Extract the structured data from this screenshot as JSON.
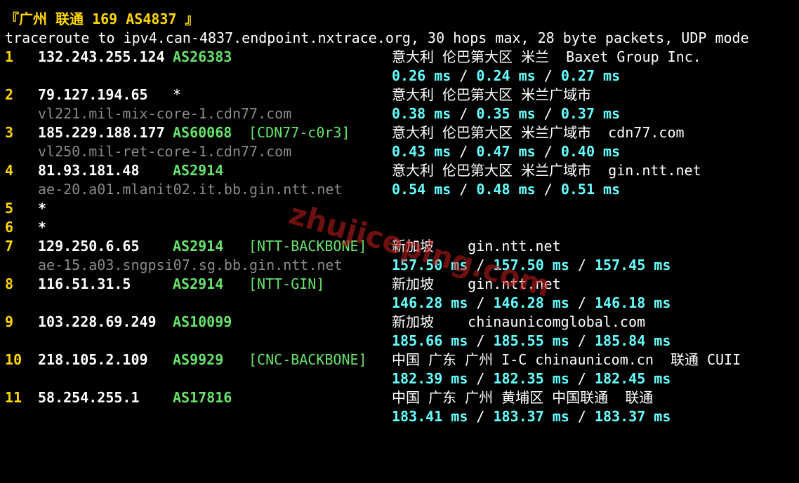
{
  "title": "『广州 联通 169 AS4837 』",
  "header": "traceroute to ipv4.can-4837.endpoint.nxtrace.org, 30 hops max, 28 byte packets, UDP mode",
  "watermark": "zhujiceping.com",
  "colors": {
    "background": "#000000",
    "hop": "#ffd700",
    "asn": "#66e36a",
    "rtt": "#66ffff",
    "rdns": "#8a8a8a",
    "text": "#ffffff"
  },
  "rtt_separator": " / ",
  "hops": [
    {
      "hop": "1",
      "ip": "132.243.255.124",
      "asn": "AS26383",
      "tag": "",
      "geo": "意大利 伦巴第大区 米兰  Baxet Group Inc.",
      "rdns": "",
      "rtt": [
        "0.26 ms",
        "0.24 ms",
        "0.27 ms"
      ]
    },
    {
      "hop": "2",
      "ip": "79.127.194.65",
      "asn": "*",
      "tag": "",
      "geo": "意大利 伦巴第大区 米兰广域市",
      "rdns": "vl221.mil-mix-core-1.cdn77.com",
      "rtt": [
        "0.38 ms",
        "0.35 ms",
        "0.37 ms"
      ]
    },
    {
      "hop": "3",
      "ip": "185.229.188.177",
      "asn": "AS60068",
      "tag": "[CDN77-c0r3]",
      "geo": "意大利 伦巴第大区 米兰广域市  cdn77.com",
      "rdns": "vl250.mil-ret-core-1.cdn77.com",
      "rtt": [
        "0.43 ms",
        "0.47 ms",
        "0.40 ms"
      ]
    },
    {
      "hop": "4",
      "ip": "81.93.181.48",
      "asn": "AS2914",
      "tag": "",
      "geo": "意大利 伦巴第大区 米兰广域市  gin.ntt.net",
      "rdns": "ae-20.a01.mlanit02.it.bb.gin.ntt.net",
      "rtt": [
        "0.54 ms",
        "0.48 ms",
        "0.51 ms"
      ]
    },
    {
      "hop": "5",
      "ip": "*",
      "asn": "",
      "tag": "",
      "geo": "",
      "rdns": "",
      "rtt": []
    },
    {
      "hop": "6",
      "ip": "*",
      "asn": "",
      "tag": "",
      "geo": "",
      "rdns": "",
      "rtt": []
    },
    {
      "hop": "7",
      "ip": "129.250.6.65",
      "asn": "AS2914",
      "tag": "[NTT-BACKBONE]",
      "geo": "新加坡    gin.ntt.net",
      "rdns": "ae-15.a03.sngpsi07.sg.bb.gin.ntt.net",
      "rtt": [
        "157.50 ms",
        "157.50 ms",
        "157.45 ms"
      ]
    },
    {
      "hop": "8",
      "ip": "116.51.31.5",
      "asn": "AS2914",
      "tag": "[NTT-GIN]",
      "geo": "新加坡    gin.ntt.net",
      "rdns": "",
      "rtt": [
        "146.28 ms",
        "146.28 ms",
        "146.18 ms"
      ]
    },
    {
      "hop": "9",
      "ip": "103.228.69.249",
      "asn": "AS10099",
      "tag": "",
      "geo": "新加坡    chinaunicomglobal.com",
      "rdns": "",
      "rtt": [
        "185.66 ms",
        "185.55 ms",
        "185.84 ms"
      ]
    },
    {
      "hop": "10",
      "ip": "218.105.2.109",
      "asn": "AS9929",
      "tag": "[CNC-BACKBONE]",
      "geo": "中国 广东 广州 I-C chinaunicom.cn  联通 CUII",
      "rdns": "",
      "rtt": [
        "182.39 ms",
        "182.35 ms",
        "182.45 ms"
      ]
    },
    {
      "hop": "11",
      "ip": "58.254.255.1",
      "asn": "AS17816",
      "tag": "",
      "geo": "中国 广东 广州 黄埔区 中国联通  联通",
      "rdns": "",
      "rtt": [
        "183.41 ms",
        "183.37 ms",
        "183.37 ms"
      ]
    }
  ]
}
